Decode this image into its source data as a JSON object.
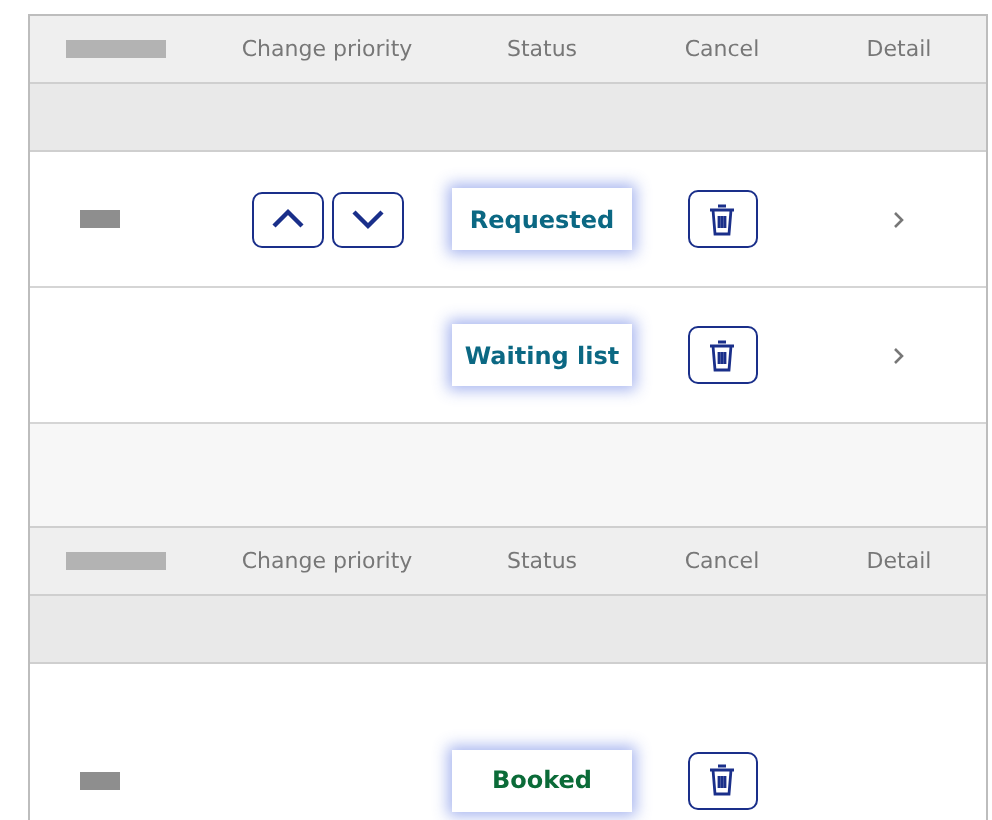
{
  "tables": [
    {
      "header_redacted": true,
      "columns": [
        "Change priority",
        "Status",
        "Cancel",
        "Detail"
      ],
      "rows": [
        {
          "redacted": true,
          "priority_controls": true,
          "status": "Requested",
          "color": "#0b6883",
          "detail": true
        },
        {
          "redacted": false,
          "priority_controls": false,
          "status": "Waiting list",
          "color": "#0b6883",
          "detail": true
        }
      ]
    },
    {
      "header_redacted": true,
      "columns": [
        "Change priority",
        "Status",
        "Cancel",
        "Detail"
      ],
      "rows": [
        {
          "redacted": true,
          "priority_controls": false,
          "status": "Booked",
          "color": "#0b6b38",
          "detail": false
        }
      ]
    }
  ]
}
